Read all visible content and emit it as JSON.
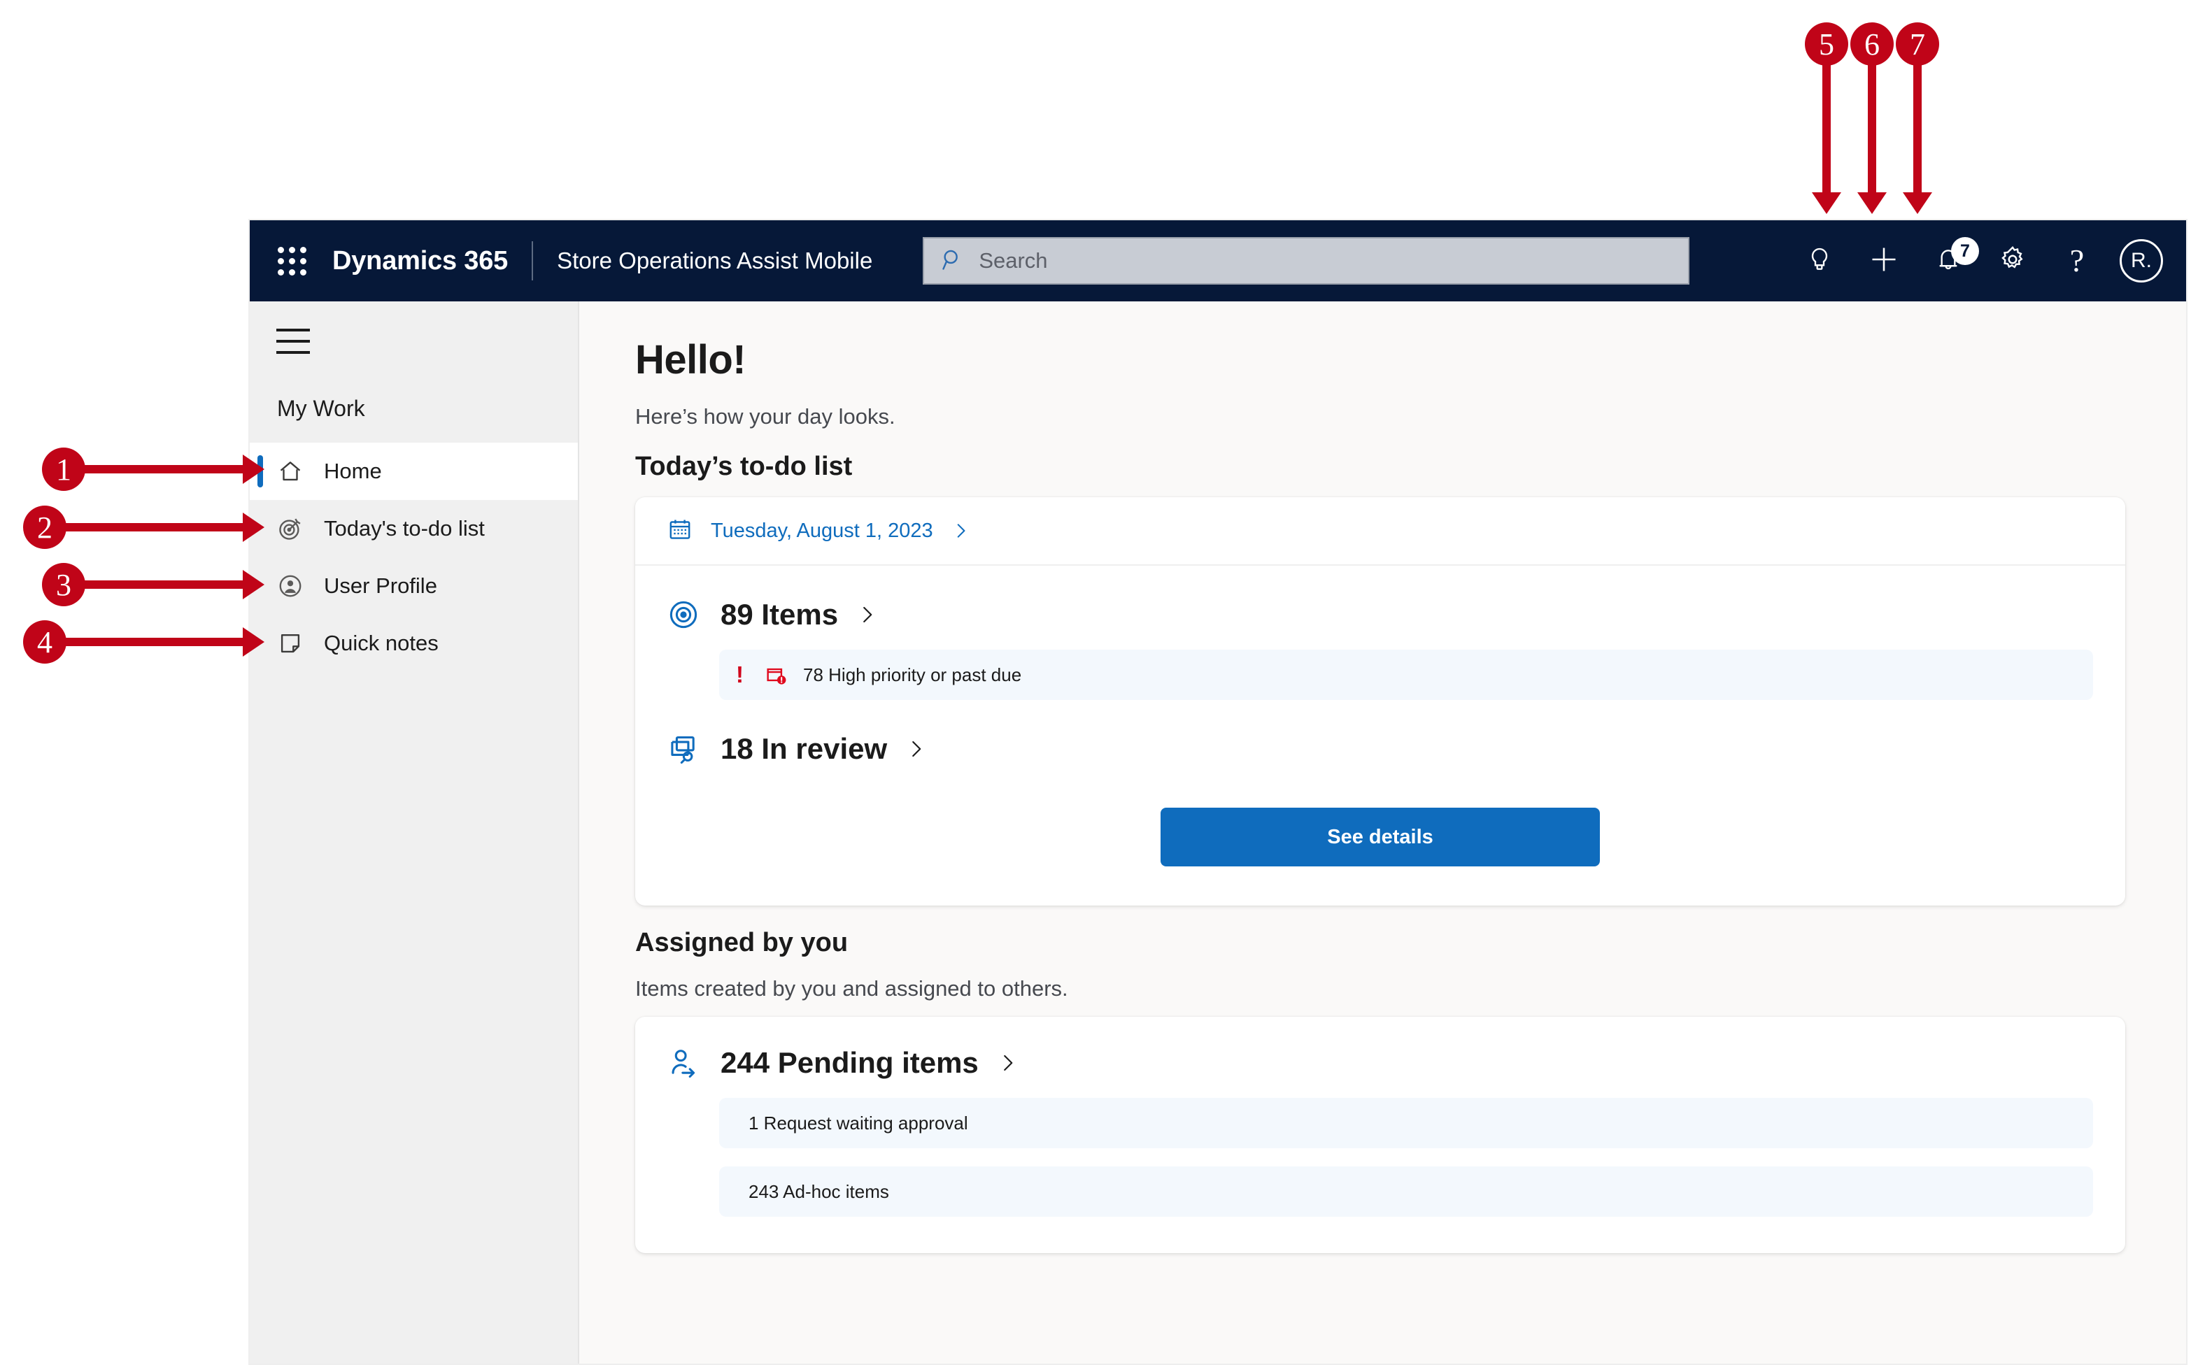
{
  "topbar": {
    "waffle_icon": "app-launcher-icon",
    "brand": "Dynamics 365",
    "app_name": "Store Operations Assist Mobile",
    "search": {
      "placeholder": "Search",
      "value": "",
      "icon": "search-icon"
    },
    "actions": [
      {
        "icon": "lightbulb-icon",
        "name": "lightbulb-button"
      },
      {
        "icon": "plus-icon",
        "name": "quick-create-button"
      },
      {
        "icon": "bell-icon",
        "name": "notifications-button",
        "badge": "7"
      },
      {
        "icon": "gear-icon",
        "name": "settings-button"
      },
      {
        "icon": "question-icon",
        "name": "help-button",
        "glyph": "?"
      }
    ],
    "avatar_initials": "R."
  },
  "sidebar": {
    "hamburger_icon": "hamburger-icon",
    "group_label": "My Work",
    "items": [
      {
        "label": "Home",
        "icon": "home-icon",
        "active": true
      },
      {
        "label": "Today's to-do list",
        "icon": "target-icon",
        "active": false
      },
      {
        "label": "User Profile",
        "icon": "user-circle-icon",
        "active": false
      },
      {
        "label": "Quick notes",
        "icon": "note-icon",
        "active": false
      }
    ]
  },
  "main": {
    "greeting": "Hello!",
    "greeting_sub": "Here’s how your day looks.",
    "todo": {
      "section_title": "Today’s to-do list",
      "date_label": "Tuesday, August 1, 2023",
      "date_icon": "calendar-icon",
      "items_count_label": "89 Items",
      "items_icon": "target-bullseye-icon",
      "priority_pill": {
        "bang": "!",
        "icon": "calendar-alert-icon",
        "text": "78 High priority or past due"
      },
      "in_review_label": "18 In review",
      "in_review_icon": "documents-search-icon",
      "see_details_label": "See details"
    },
    "assigned": {
      "section_title": "Assigned by you",
      "section_desc": "Items created by you and assigned to others.",
      "pending_label": "244 Pending items",
      "pending_icon": "person-arrow-icon",
      "rows": [
        {
          "text": "1 Request waiting approval"
        },
        {
          "text": "243 Ad-hoc items"
        }
      ]
    }
  },
  "annotations": {
    "color": "#c00418",
    "badges": [
      {
        "number": "1",
        "target": "sidebar-item-home"
      },
      {
        "number": "2",
        "target": "sidebar-item-todays-to-do-list"
      },
      {
        "number": "3",
        "target": "sidebar-item-user-profile"
      },
      {
        "number": "4",
        "target": "sidebar-item-quick-notes"
      },
      {
        "number": "5",
        "target": "quick-create-button"
      },
      {
        "number": "6",
        "target": "notifications-button"
      },
      {
        "number": "7",
        "target": "settings-button"
      }
    ]
  }
}
